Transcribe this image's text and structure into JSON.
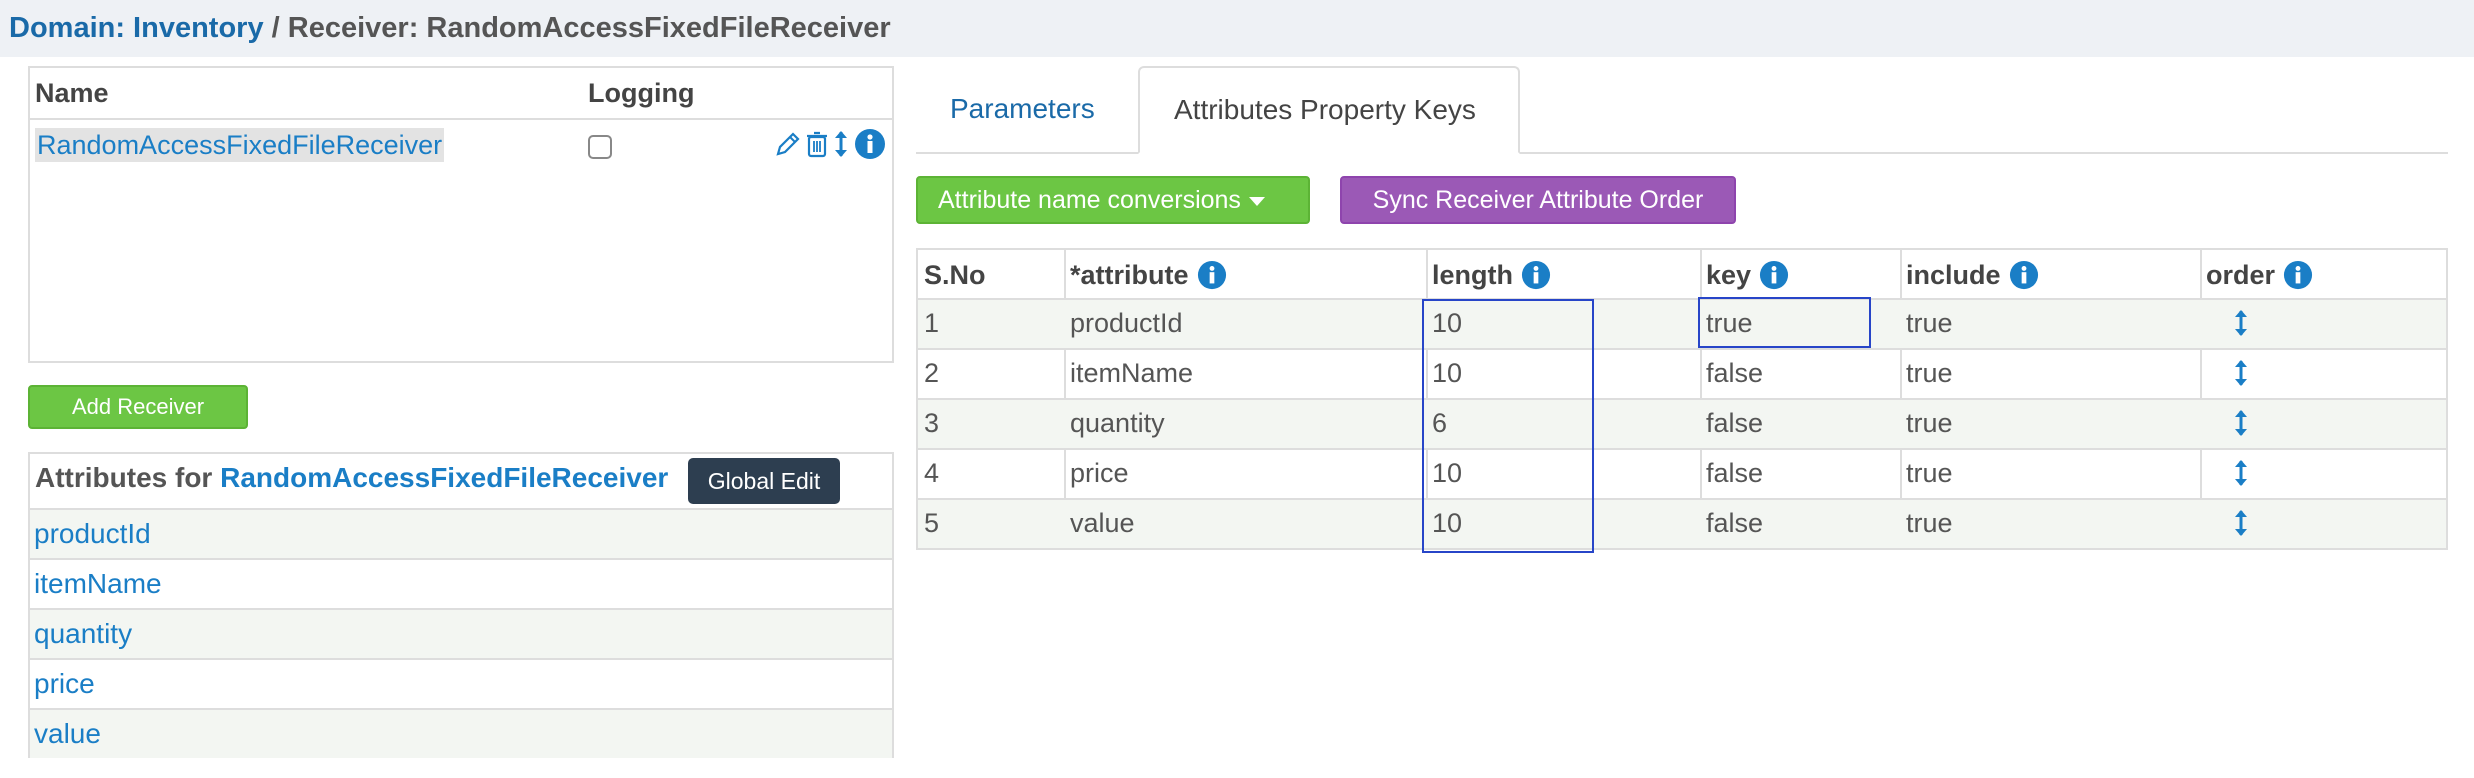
{
  "breadcrumb": {
    "domain_label": "Domain: Inventory",
    "separator": " / ",
    "receiver_label": "Receiver: RandomAccessFixedFileReceiver"
  },
  "receivers_table": {
    "col_name": "Name",
    "col_logging": "Logging",
    "rows": [
      {
        "name": "RandomAccessFixedFileReceiver",
        "logging": false
      }
    ]
  },
  "add_receiver_label": "Add Receiver",
  "attributes_panel": {
    "title_prefix": "Attributes for ",
    "receiver_name": "RandomAccessFixedFileReceiver",
    "global_edit_label": "Global Edit",
    "items": [
      "productId",
      "itemName",
      "quantity",
      "price",
      "value"
    ]
  },
  "tabs": {
    "parameters": "Parameters",
    "attributes_property_keys": "Attributes Property Keys"
  },
  "actions": {
    "conversions_label": "Attribute name conversions",
    "sync_label": "Sync Receiver Attribute Order"
  },
  "grid": {
    "headers": {
      "sno": "S.No",
      "attribute": "*attribute",
      "length": "length",
      "key": "key",
      "include": "include",
      "order": "order"
    },
    "rows": [
      {
        "sno": "1",
        "attribute": "productId",
        "length": "10",
        "key": "true",
        "include": "true"
      },
      {
        "sno": "2",
        "attribute": "itemName",
        "length": "10",
        "key": "false",
        "include": "true"
      },
      {
        "sno": "3",
        "attribute": "quantity",
        "length": "6",
        "key": "false",
        "include": "true"
      },
      {
        "sno": "4",
        "attribute": "price",
        "length": "10",
        "key": "false",
        "include": "true"
      },
      {
        "sno": "5",
        "attribute": "value",
        "length": "10",
        "key": "false",
        "include": "true"
      }
    ]
  },
  "colors": {
    "link": "#1a7ec6",
    "green_button": "#6cc644",
    "purple_button": "#9b59b6",
    "dark_button": "#2d3e50",
    "selection_outline": "#2745c8"
  },
  "icons": {
    "row_actions": [
      "pencil-icon",
      "trash-icon",
      "reorder-icon",
      "info-icon"
    ],
    "header_info": "info-icon",
    "order": "vertical-arrows-icon"
  }
}
